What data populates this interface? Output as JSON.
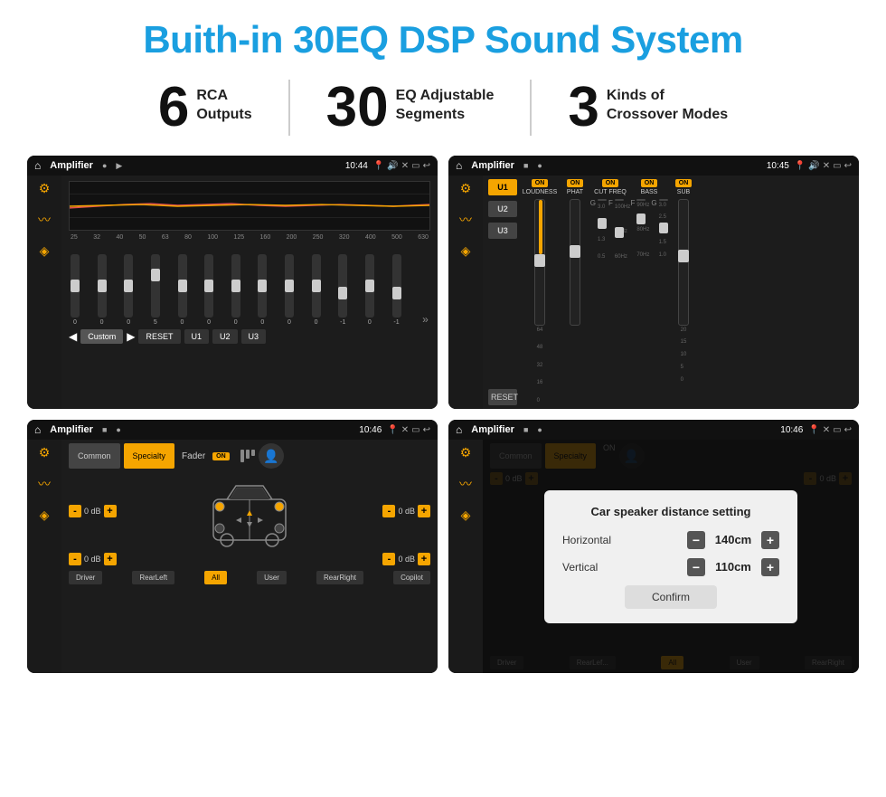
{
  "page": {
    "title": "Buith-in 30EQ DSP Sound System",
    "accent_color": "#1a9fe0"
  },
  "stats": [
    {
      "number": "6",
      "line1": "RCA",
      "line2": "Outputs"
    },
    {
      "number": "30",
      "line1": "EQ Adjustable",
      "line2": "Segments"
    },
    {
      "number": "3",
      "line1": "Kinds of",
      "line2": "Crossover Modes"
    }
  ],
  "screens": [
    {
      "id": "screen1",
      "status_bar": {
        "app": "Amplifier",
        "time": "10:44"
      }
    },
    {
      "id": "screen2",
      "status_bar": {
        "app": "Amplifier",
        "time": "10:45"
      }
    },
    {
      "id": "screen3",
      "status_bar": {
        "app": "Amplifier",
        "time": "10:46"
      }
    },
    {
      "id": "screen4",
      "status_bar": {
        "app": "Amplifier",
        "time": "10:46"
      },
      "dialog": {
        "title": "Car speaker distance setting",
        "horizontal_label": "Horizontal",
        "horizontal_value": "140cm",
        "vertical_label": "Vertical",
        "vertical_value": "110cm",
        "confirm_label": "Confirm"
      }
    }
  ],
  "eq_freqs": [
    "25",
    "32",
    "40",
    "50",
    "63",
    "80",
    "100",
    "125",
    "160",
    "200",
    "250",
    "320",
    "400",
    "500",
    "630"
  ],
  "eq_vals": [
    "0",
    "0",
    "0",
    "5",
    "0",
    "0",
    "0",
    "0",
    "0",
    "0",
    "0",
    "0",
    "-1",
    "0",
    "-1"
  ],
  "eq_buttons": [
    "Custom",
    "RESET",
    "U1",
    "U2",
    "U3"
  ],
  "amp_channels": [
    {
      "label": "LOUDNESS",
      "on": true
    },
    {
      "label": "PHAT",
      "on": true
    },
    {
      "label": "CUT FREQ",
      "on": true
    },
    {
      "label": "BASS",
      "on": true
    },
    {
      "label": "SUB",
      "on": true
    }
  ],
  "presets": [
    "U1",
    "U2",
    "U3"
  ],
  "tabs": [
    "Common",
    "Specialty"
  ],
  "locations": [
    "Driver",
    "RearLeft",
    "All",
    "User",
    "RearRight",
    "Copilot"
  ],
  "fader": {
    "label": "Fader",
    "on": true
  }
}
